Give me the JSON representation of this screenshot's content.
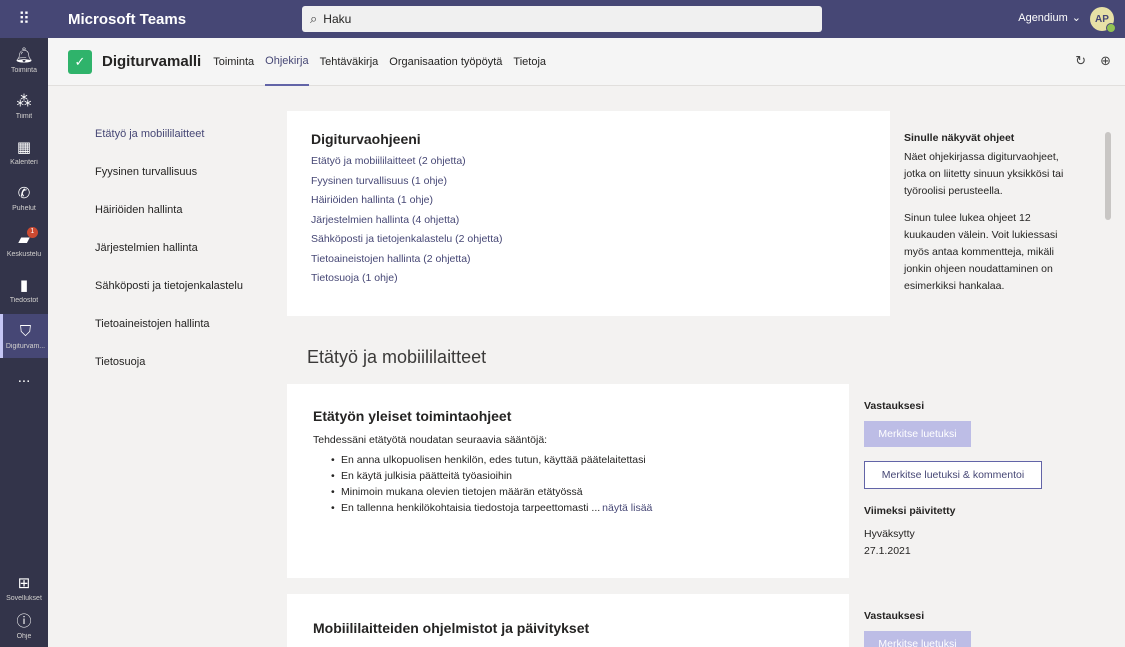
{
  "topbar": {
    "app_title": "Microsoft Teams",
    "search_placeholder": "Haku",
    "org_name": "Agendium",
    "avatar_initials": "AP"
  },
  "rail": {
    "items": [
      {
        "label": "Toiminta",
        "icon": "bell-icon"
      },
      {
        "label": "Tiimit",
        "icon": "teams-icon"
      },
      {
        "label": "Kalenteri",
        "icon": "calendar-icon"
      },
      {
        "label": "Puhelut",
        "icon": "phone-icon"
      },
      {
        "label": "Keskustelu",
        "icon": "chat-icon",
        "badge": "1"
      },
      {
        "label": "Tiedostot",
        "icon": "files-icon"
      },
      {
        "label": "Digiturvam...",
        "icon": "shield-icon"
      },
      {
        "label": "...",
        "icon": "more-icon"
      },
      {
        "label": "Sovellukset",
        "icon": "apps-icon"
      },
      {
        "label": "Ohje",
        "icon": "help-icon"
      }
    ]
  },
  "app": {
    "name": "Digiturvamalli",
    "tabs": [
      "Toiminta",
      "Ohjekirja",
      "Tehtäväkirja",
      "Organisaation työpöytä",
      "Tietoja"
    ],
    "active_tab": "Ohjekirja"
  },
  "leftnav": {
    "items": [
      "Etätyö ja mobiililaitteet",
      "Fyysinen turvallisuus",
      "Häiriöiden hallinta",
      "Järjestelmien hallinta",
      "Sähköposti ja tietojenkalastelu",
      "Tietoaineistojen hallinta",
      "Tietosuoja"
    ]
  },
  "summary": {
    "title": "Digiturvaohjeeni",
    "links": [
      "Etätyö ja mobiililaitteet (2 ohjetta)",
      "Fyysinen turvallisuus (1 ohje)",
      "Häiriöiden hallinta (1 ohje)",
      "Järjestelmien hallinta (4 ohjetta)",
      "Sähköposti ja tietojenkalastelu (2 ohjetta)",
      "Tietoaineistojen hallinta (2 ohjetta)",
      "Tietosuoja (1 ohje)"
    ]
  },
  "aside": {
    "title": "Sinulle näkyvät ohjeet",
    "p1": "Näet ohjekirjassa digiturvaohjeet, jotka on liitetty sinuun yksikkösi tai työroolisi perusteella.",
    "p2": "Sinun tulee lukea ohjeet 12 kuukauden välein. Voit lukiessasi myös antaa kommentteja, mikäli jonkin ohjeen noudattaminen on esimerkiksi hankalaa."
  },
  "section_title": "Etätyö ja mobiililaitteet",
  "guides": [
    {
      "title": "Etätyön yleiset toimintaohjeet",
      "intro": "Tehdessäni etätyötä noudatan seuraavia sääntöjä:",
      "bullets": [
        "En anna ulkopuolisen henkilön, edes tutun, käyttää päätelaitettasi",
        "En käytä julkisia päätteitä työasioihin",
        "Minimoin mukana olevien tietojen määrän etätyössä",
        "En tallenna henkilökohtaisia tiedostoja tarpeettomasti ..."
      ],
      "more": "näytä lisää",
      "answers_title": "Vastauksesi",
      "mark_read": "Merkitse luetuksi",
      "mark_comment": "Merkitse luetuksi & kommentoi",
      "updated_title": "Viimeksi päivitetty",
      "status": "Hyväksytty",
      "date": "27.1.2021"
    },
    {
      "title": "Mobiililaitteiden ohjelmistot ja päivitykset",
      "answers_title": "Vastauksesi",
      "mark_read": "Merkitse luetuksi"
    }
  ]
}
